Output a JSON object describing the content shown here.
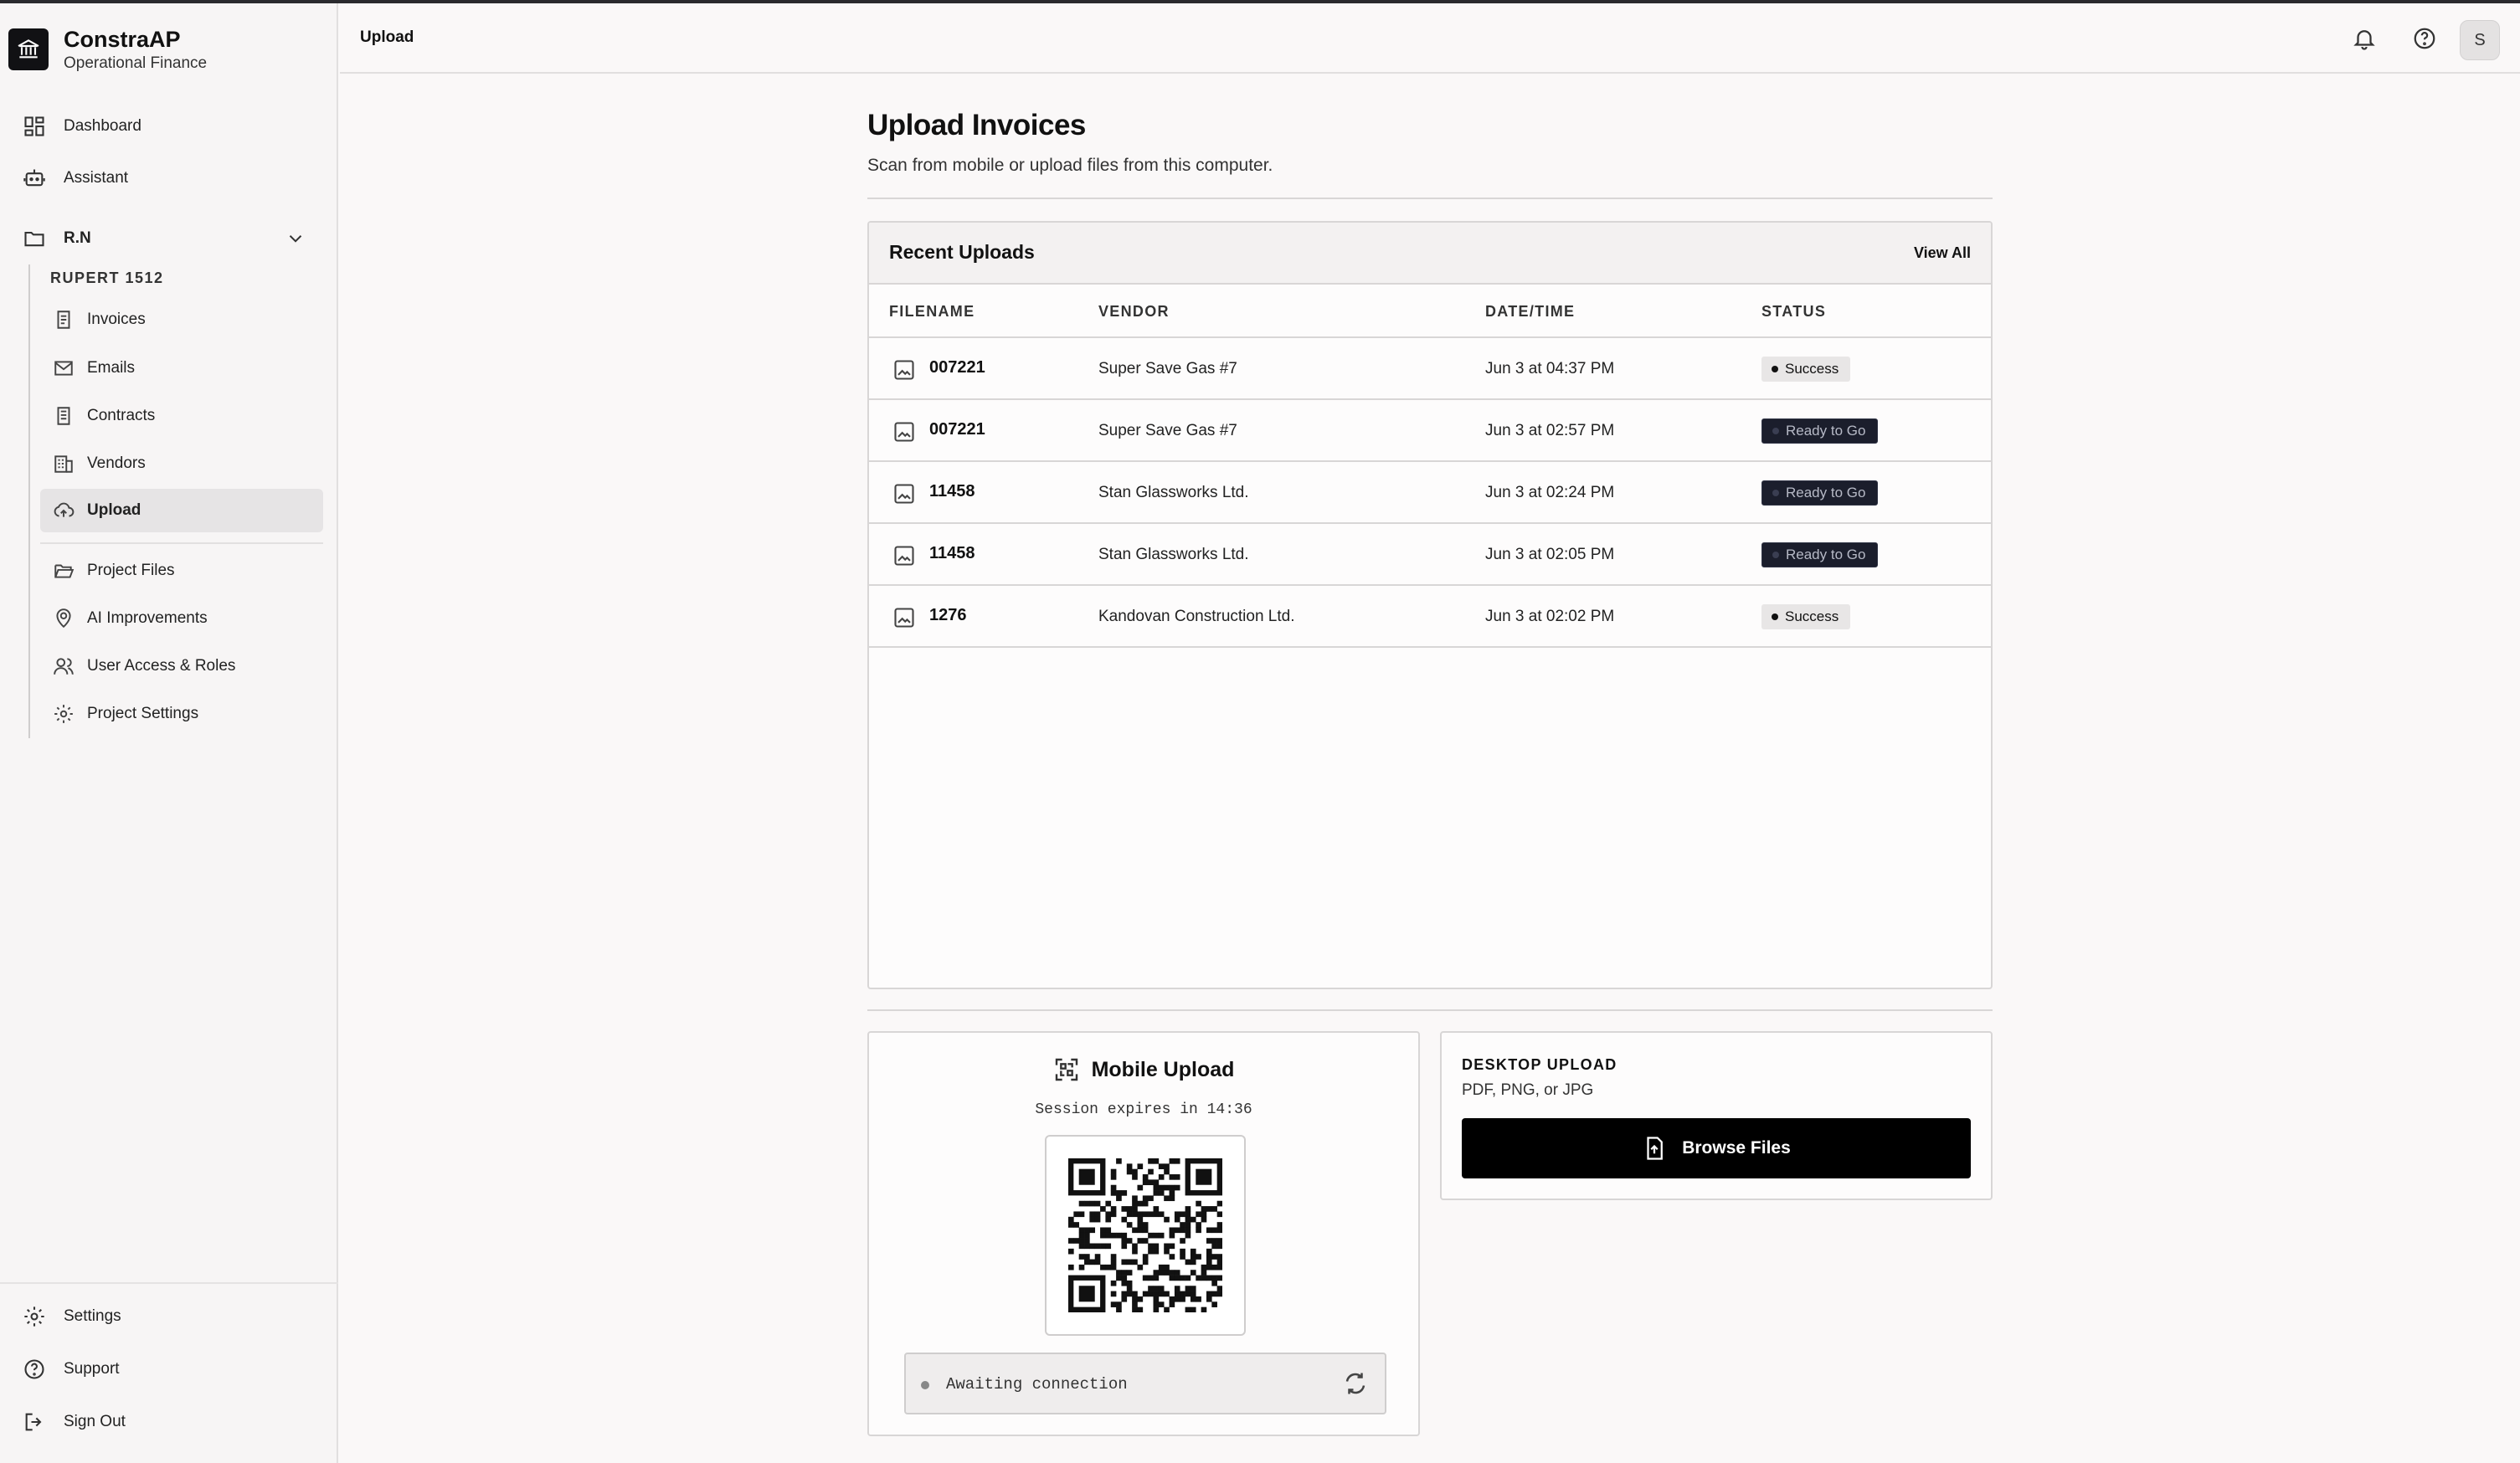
{
  "brand": {
    "name": "ConstraAP",
    "subtitle": "Operational Finance"
  },
  "header": {
    "title": "Upload",
    "avatar_initial": "S"
  },
  "sidebar": {
    "top_items": [
      {
        "label": "Dashboard",
        "icon": "dashboard-icon"
      },
      {
        "label": "Assistant",
        "icon": "robot-icon"
      }
    ],
    "folder": {
      "label": "R.N",
      "icon": "folder-icon"
    },
    "project_label": "RUPERT 1512",
    "project_items": [
      {
        "label": "Invoices",
        "icon": "invoice-icon"
      },
      {
        "label": "Emails",
        "icon": "mail-icon"
      },
      {
        "label": "Contracts",
        "icon": "contract-icon"
      },
      {
        "label": "Vendors",
        "icon": "building-icon"
      },
      {
        "label": "Upload",
        "icon": "cloud-upload-icon",
        "active": true
      }
    ],
    "project_extra": [
      {
        "label": "Project Files",
        "icon": "folder-open-icon"
      },
      {
        "label": "AI Improvements",
        "icon": "ai-pin-icon"
      },
      {
        "label": "User Access & Roles",
        "icon": "users-icon"
      },
      {
        "label": "Project Settings",
        "icon": "gear-icon"
      }
    ],
    "bottom_items": [
      {
        "label": "Settings",
        "icon": "gear-icon"
      },
      {
        "label": "Support",
        "icon": "help-icon"
      },
      {
        "label": "Sign Out",
        "icon": "sign-out-icon"
      }
    ]
  },
  "main": {
    "title": "Upload Invoices",
    "subtitle": "Scan from mobile or upload files from this computer."
  },
  "recent": {
    "title": "Recent Uploads",
    "view_all": "View All",
    "columns": [
      "FILENAME",
      "VENDOR",
      "DATE/TIME",
      "STATUS"
    ],
    "rows": [
      {
        "filename": "007221",
        "vendor": "Super Save Gas #7",
        "datetime": "Jun 3 at 04:37 PM",
        "status": "Success",
        "kind": "success"
      },
      {
        "filename": "007221",
        "vendor": "Super Save Gas #7",
        "datetime": "Jun 3 at 02:57 PM",
        "status": "Ready to Go",
        "kind": "ready"
      },
      {
        "filename": "11458",
        "vendor": "Stan Glassworks Ltd.",
        "datetime": "Jun 3 at 02:24 PM",
        "status": "Ready to Go",
        "kind": "ready"
      },
      {
        "filename": "11458",
        "vendor": "Stan Glassworks Ltd.",
        "datetime": "Jun 3 at 02:05 PM",
        "status": "Ready to Go",
        "kind": "ready"
      },
      {
        "filename": "1276",
        "vendor": "Kandovan Construction Ltd.",
        "datetime": "Jun 3 at 02:02 PM",
        "status": "Success",
        "kind": "success"
      }
    ]
  },
  "mobile": {
    "title": "Mobile Upload",
    "session": "Session expires in 14:36",
    "status": "Awaiting connection"
  },
  "desktop": {
    "title": "DESKTOP UPLOAD",
    "formats": "PDF, PNG, or JPG",
    "button": "Browse Files"
  }
}
